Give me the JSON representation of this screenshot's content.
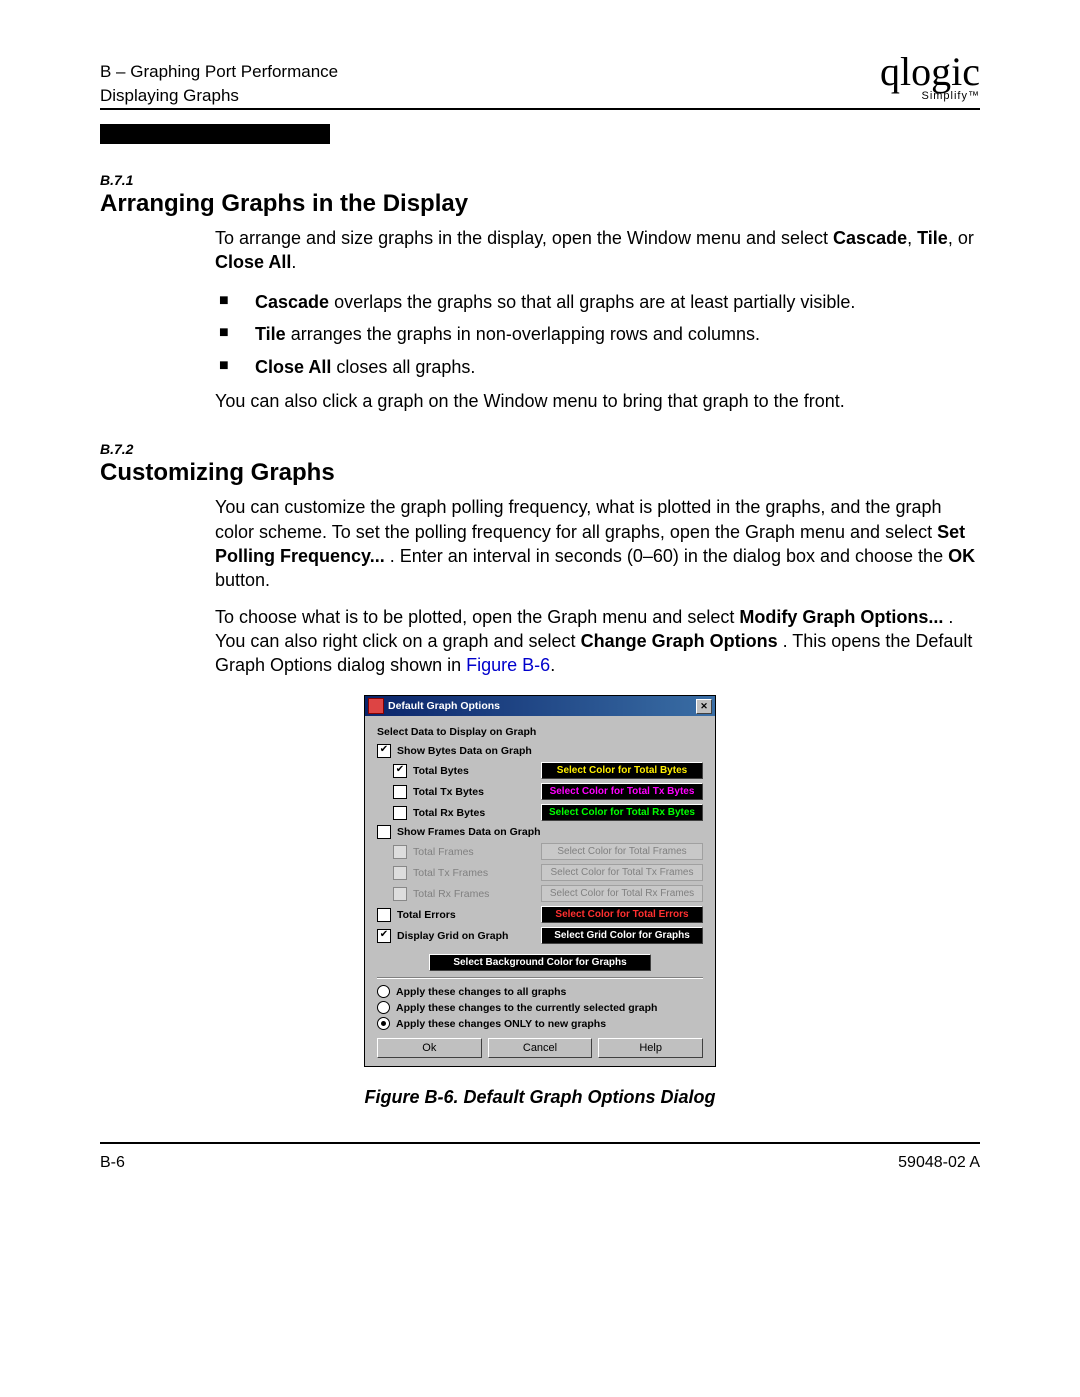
{
  "header": {
    "line1": "B – Graphing Port Performance",
    "line2": "Displaying Graphs",
    "logo_text": "qlogic",
    "logo_sub": "Simplify™"
  },
  "sec1": {
    "num": "B.7.1",
    "title": "Arranging Graphs in the Display",
    "intro_a": "To arrange and size graphs in the display, open the Window menu and select ",
    "intro_b": "Cascade",
    "intro_c": ", ",
    "intro_d": "Tile",
    "intro_e": ", or ",
    "intro_f": "Close All",
    "intro_g": ".",
    "li1_b": "Cascade",
    "li1_t": " overlaps the graphs so that all graphs are at least partially visible.",
    "li2_b": "Tile",
    "li2_t": " arranges the graphs in non-overlapping rows and columns.",
    "li3_b": "Close All",
    "li3_t": " closes all graphs.",
    "after": "You can also click a graph on the Window menu to bring that graph to the front."
  },
  "sec2": {
    "num": "B.7.2",
    "title": "Customizing Graphs",
    "p1_a": "You can customize the graph polling frequency, what is plotted in the graphs, and the graph color scheme. To set the polling frequency for all graphs, open the Graph menu and select ",
    "p1_b": "Set Polling Frequency...",
    "p1_c": ". Enter an interval in seconds (0–60) in the dialog box and choose the ",
    "p1_d": "OK",
    "p1_e": " button.",
    "p2_a": "To choose what is to be plotted, open the Graph menu and select ",
    "p2_b": "Modify Graph Options...",
    "p2_c": ". You can also right click on a graph and select ",
    "p2_d": "Change Graph Options",
    "p2_e": ". This opens the Default Graph Options dialog shown in ",
    "p2_link": "Figure B-6",
    "p2_f": "."
  },
  "dialog": {
    "title": "Default Graph Options",
    "select_data": "Select Data to Display on Graph",
    "show_bytes": "Show Bytes Data on Graph",
    "total_bytes": "Total Bytes",
    "total_tx_bytes": "Total Tx Bytes",
    "total_rx_bytes": "Total Rx Bytes",
    "show_frames": "Show Frames Data on Graph",
    "total_frames": "Total Frames",
    "total_tx_frames": "Total Tx Frames",
    "total_rx_frames": "Total Rx Frames",
    "total_errors": "Total Errors",
    "display_grid": "Display Grid on Graph",
    "btn_total_bytes": "Select Color for Total Bytes",
    "btn_total_tx_bytes": "Select Color for Total Tx Bytes",
    "btn_total_rx_bytes": "Select Color for Total Rx Bytes",
    "btn_total_frames": "Select Color for Total Frames",
    "btn_total_tx_frames": "Select Color for Total Tx Frames",
    "btn_total_rx_frames": "Select Color for Total Rx Frames",
    "btn_total_errors": "Select Color for Total Errors",
    "btn_grid_color": "Select Grid Color for Graphs",
    "btn_bg_color": "Select Background Color for Graphs",
    "radio1": "Apply these changes to all graphs",
    "radio2": "Apply these changes to the currently selected graph",
    "radio3": "Apply these changes ONLY to new graphs",
    "ok": "Ok",
    "cancel": "Cancel",
    "help": "Help"
  },
  "figure_caption": "Figure B-6.  Default Graph Options Dialog",
  "footer": {
    "page": "B-6",
    "doc": "59048-02  A"
  }
}
